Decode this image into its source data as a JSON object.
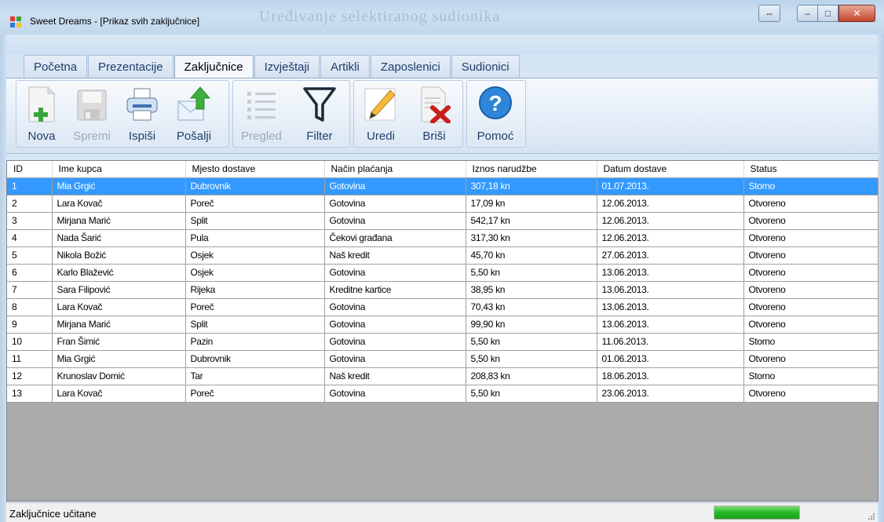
{
  "window": {
    "title": "Sweet Dreams - [Prikaz svih zaključnice]",
    "background_title": "Uređivanje selektiranog sudionika",
    "controls": {
      "swap": "⇔",
      "minimize": "–",
      "maximize": "□",
      "close": "✕"
    }
  },
  "tabs": [
    {
      "label": "Početna",
      "active": false
    },
    {
      "label": "Prezentacije",
      "active": false
    },
    {
      "label": "Zaključnice",
      "active": true
    },
    {
      "label": "Izvještaji",
      "active": false
    },
    {
      "label": "Artikli",
      "active": false
    },
    {
      "label": "Zaposlenici",
      "active": false
    },
    {
      "label": "Sudionici",
      "active": false
    }
  ],
  "ribbon": {
    "new_label": "Nova",
    "save_label": "Spremi",
    "print_label": "Ispiši",
    "send_label": "Pošalji",
    "preview_label": "Pregled",
    "filter_label": "Filter",
    "edit_label": "Uredi",
    "delete_label": "Briši",
    "help_label": "Pomoć"
  },
  "grid": {
    "columns": [
      "ID",
      "Ime kupca",
      "Mjesto dostave",
      "Način plaćanja",
      "Iznos narudžbe",
      "Datum dostave",
      "Status"
    ],
    "selected_row": 0,
    "rows": [
      [
        "1",
        "Mia Grgić",
        "Dubrovnik",
        "Gotovina",
        "307,18 kn",
        "01.07.2013.",
        "Storno"
      ],
      [
        "2",
        "Lara Kovač",
        "Poreč",
        "Gotovina",
        "17,09 kn",
        "12.06.2013.",
        "Otvoreno"
      ],
      [
        "3",
        "Mirjana Marić",
        "Split",
        "Gotovina",
        "542,17 kn",
        "12.06.2013.",
        "Otvoreno"
      ],
      [
        "4",
        "Nada Šarić",
        "Pula",
        "Čekovi građana",
        "317,30 kn",
        "12.06.2013.",
        "Otvoreno"
      ],
      [
        "5",
        "Nikola Božić",
        "Osjek",
        "Naš kredit",
        "45,70 kn",
        "27.06.2013.",
        "Otvoreno"
      ],
      [
        "6",
        "Karlo Blažević",
        "Osjek",
        "Gotovina",
        "5,50 kn",
        "13.06.2013.",
        "Otvoreno"
      ],
      [
        "7",
        "Sara Filipović",
        "Rijeka",
        "Kreditne kartice",
        "38,95 kn",
        "13.06.2013.",
        "Otvoreno"
      ],
      [
        "8",
        "Lara Kovač",
        "Poreč",
        "Gotovina",
        "70,43 kn",
        "13.06.2013.",
        "Otvoreno"
      ],
      [
        "9",
        "Mirjana Marić",
        "Split",
        "Gotovina",
        "99,90 kn",
        "13.06.2013.",
        "Otvoreno"
      ],
      [
        "10",
        "Fran Šimić",
        "Pazin",
        "Gotovina",
        "5,50 kn",
        "11.06.2013.",
        "Storno"
      ],
      [
        "11",
        "Mia Grgić",
        "Dubrovnik",
        "Gotovina",
        "5,50 kn",
        "01.06.2013.",
        "Otvoreno"
      ],
      [
        "12",
        "Krunoslav Domić",
        "Tar",
        "Naš kredit",
        "208,83 kn",
        "18.06.2013.",
        "Storno"
      ],
      [
        "13",
        "Lara Kovač",
        "Poreč",
        "Gotovina",
        "5,50 kn",
        "23.06.2013.",
        "Otvoreno"
      ]
    ]
  },
  "status": {
    "text": "Zaključnice učitane",
    "progress": 1.0
  },
  "colors": {
    "selection": "#3399ff",
    "grid_empty": "#ababab",
    "progress": "#26b826",
    "tab_text": "#1f3f6b"
  }
}
